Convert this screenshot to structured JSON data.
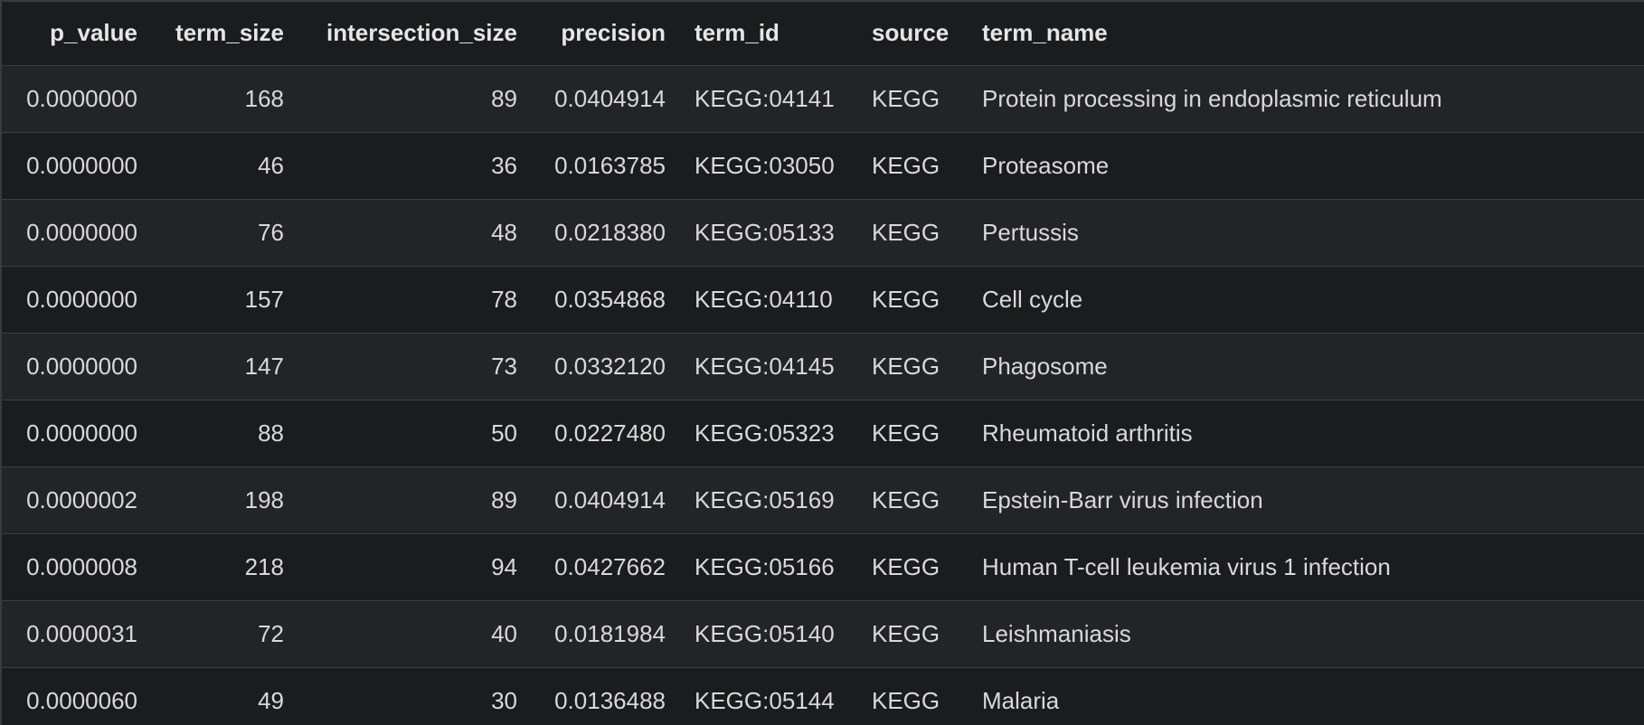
{
  "table": {
    "columns": [
      "p_value",
      "term_size",
      "intersection_size",
      "precision",
      "term_id",
      "source",
      "term_name"
    ],
    "rows": [
      [
        "0.0000000",
        "168",
        "89",
        "0.0404914",
        "KEGG:04141",
        "KEGG",
        "Protein processing in endoplasmic reticulum"
      ],
      [
        "0.0000000",
        "46",
        "36",
        "0.0163785",
        "KEGG:03050",
        "KEGG",
        "Proteasome"
      ],
      [
        "0.0000000",
        "76",
        "48",
        "0.0218380",
        "KEGG:05133",
        "KEGG",
        "Pertussis"
      ],
      [
        "0.0000000",
        "157",
        "78",
        "0.0354868",
        "KEGG:04110",
        "KEGG",
        "Cell cycle"
      ],
      [
        "0.0000000",
        "147",
        "73",
        "0.0332120",
        "KEGG:04145",
        "KEGG",
        "Phagosome"
      ],
      [
        "0.0000000",
        "88",
        "50",
        "0.0227480",
        "KEGG:05323",
        "KEGG",
        "Rheumatoid arthritis"
      ],
      [
        "0.0000002",
        "198",
        "89",
        "0.0404914",
        "KEGG:05169",
        "KEGG",
        "Epstein-Barr virus infection"
      ],
      [
        "0.0000008",
        "218",
        "94",
        "0.0427662",
        "KEGG:05166",
        "KEGG",
        "Human T-cell leukemia virus 1 infection"
      ],
      [
        "0.0000031",
        "72",
        "40",
        "0.0181984",
        "KEGG:05140",
        "KEGG",
        "Leishmaniasis"
      ],
      [
        "0.0000060",
        "49",
        "30",
        "0.0136488",
        "KEGG:05144",
        "KEGG",
        "Malaria"
      ]
    ]
  }
}
